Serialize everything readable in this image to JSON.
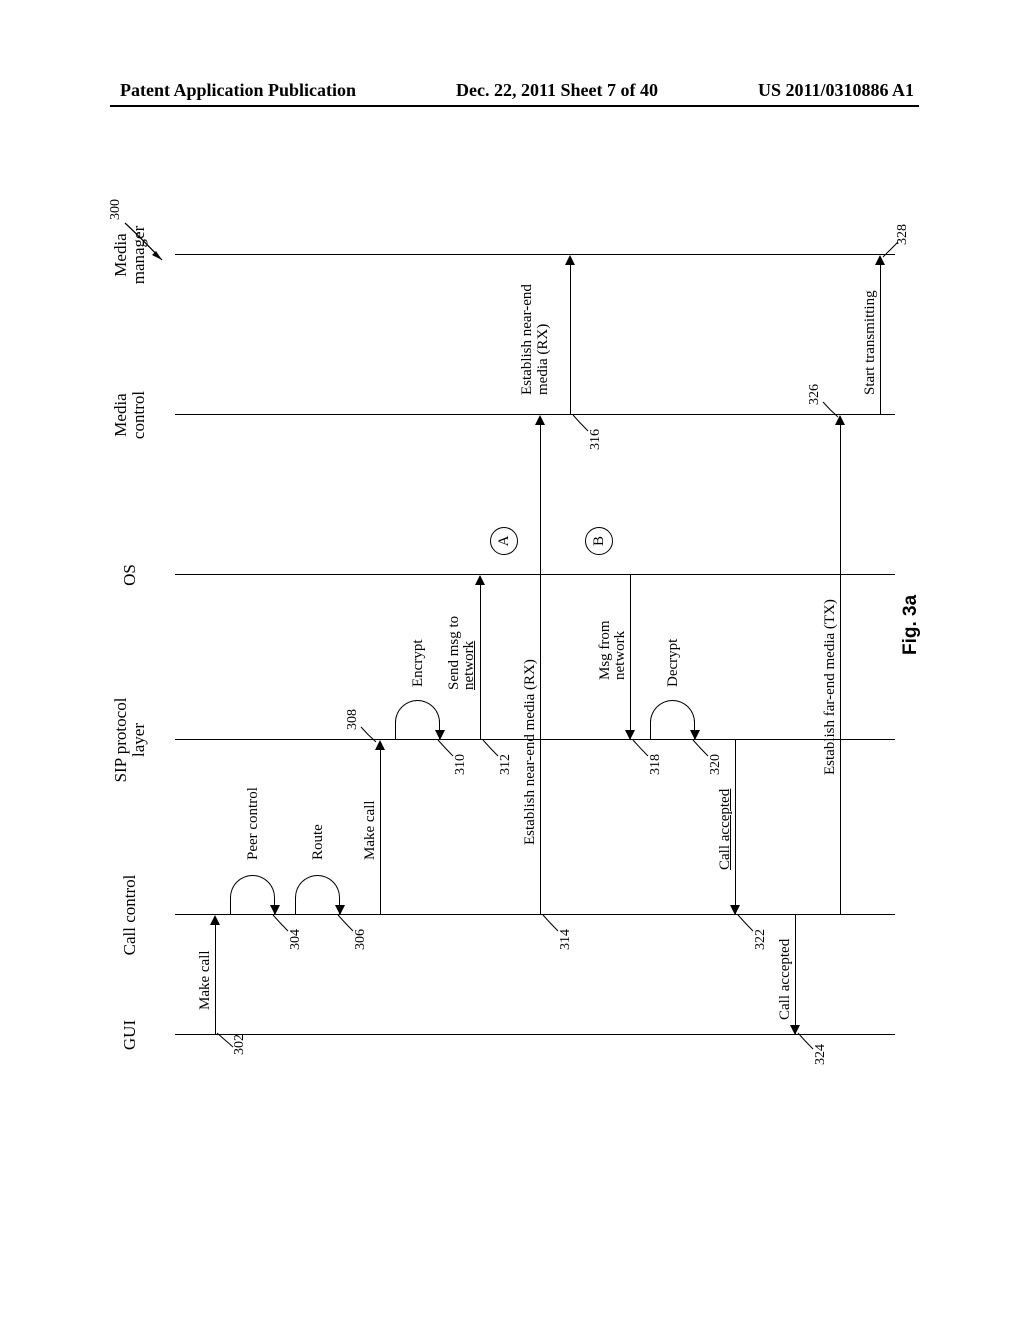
{
  "header": {
    "left": "Patent Application Publication",
    "center": "Dec. 22, 2011  Sheet 7 of 40",
    "right": "US 2011/0310886 A1"
  },
  "figure_label": "Fig. 3a",
  "diagram_ref": "300",
  "lifelines": {
    "gui": "GUI",
    "call_control": "Call control",
    "sip": "SIP protocol layer",
    "os": "OS",
    "media_control": "Media control",
    "media_manager": "Media manager"
  },
  "refs": {
    "r302": "302",
    "r304": "304",
    "r306": "306",
    "r308": "308",
    "r310": "310",
    "r312": "312",
    "r314": "314",
    "r316": "316",
    "r318": "318",
    "r320": "320",
    "r322": "322",
    "r324": "324",
    "r326": "326",
    "r328": "328"
  },
  "messages": {
    "make_call_1": "Make call",
    "peer_control": "Peer control",
    "route": "Route",
    "make_call_2": "Make call",
    "encrypt": "Encrypt",
    "send_msg": "Send msg to network",
    "est_near_rx_1": "Establish near-end media (RX)",
    "est_near_rx_2": "Establish near-end media (RX)",
    "msg_from_net": "Msg from network",
    "decrypt": "Decrypt",
    "call_accepted_1": "Call accepted",
    "call_accepted_2": "Call accepted",
    "est_far_tx": "Establish far-end media (TX)",
    "start_tx": "Start transmitting"
  },
  "markers": {
    "a": "A",
    "b": "B"
  },
  "chart_data": {
    "type": "sequence_diagram",
    "ref": "300",
    "lifelines": [
      "GUI",
      "Call control",
      "SIP protocol layer",
      "OS",
      "Media control",
      "Media manager"
    ],
    "interactions": [
      {
        "ref": "302",
        "from": "GUI",
        "to": "Call control",
        "label": "Make call"
      },
      {
        "ref": "304",
        "from": "Call control",
        "to": "Call control",
        "label": "Peer control",
        "type": "self"
      },
      {
        "ref": "306",
        "from": "Call control",
        "to": "Call control",
        "label": "Route",
        "type": "self"
      },
      {
        "ref": "308",
        "from": "Call control",
        "to": "SIP protocol layer",
        "label": "Make call"
      },
      {
        "ref": "310",
        "from": "SIP protocol layer",
        "to": "SIP protocol layer",
        "label": "Encrypt",
        "type": "self"
      },
      {
        "ref": "312",
        "from": "SIP protocol layer",
        "to": "OS",
        "label": "Send msg to network"
      },
      {
        "marker": "A",
        "at": "OS"
      },
      {
        "ref": "314",
        "from": "Call control",
        "to": "Media control",
        "label": "Establish near-end media (RX)"
      },
      {
        "ref": "316",
        "from": "Media control",
        "to": "Media manager",
        "label": "Establish near-end media (RX)"
      },
      {
        "marker": "B",
        "at": "OS"
      },
      {
        "ref": "318",
        "from": "OS",
        "to": "SIP protocol layer",
        "label": "Msg from network"
      },
      {
        "ref": "320",
        "from": "SIP protocol layer",
        "to": "SIP protocol layer",
        "label": "Decrypt",
        "type": "self"
      },
      {
        "ref": "322",
        "from": "SIP protocol layer",
        "to": "Call control",
        "label": "Call accepted"
      },
      {
        "ref": "324",
        "from": "Call control",
        "to": "GUI",
        "label": "Call accepted"
      },
      {
        "ref": "326",
        "from": "Call control",
        "to": "Media control",
        "label": "Establish far-end media (TX)"
      },
      {
        "ref": "328",
        "from": "Media control",
        "to": "Media manager",
        "label": "Start transmitting"
      }
    ]
  }
}
